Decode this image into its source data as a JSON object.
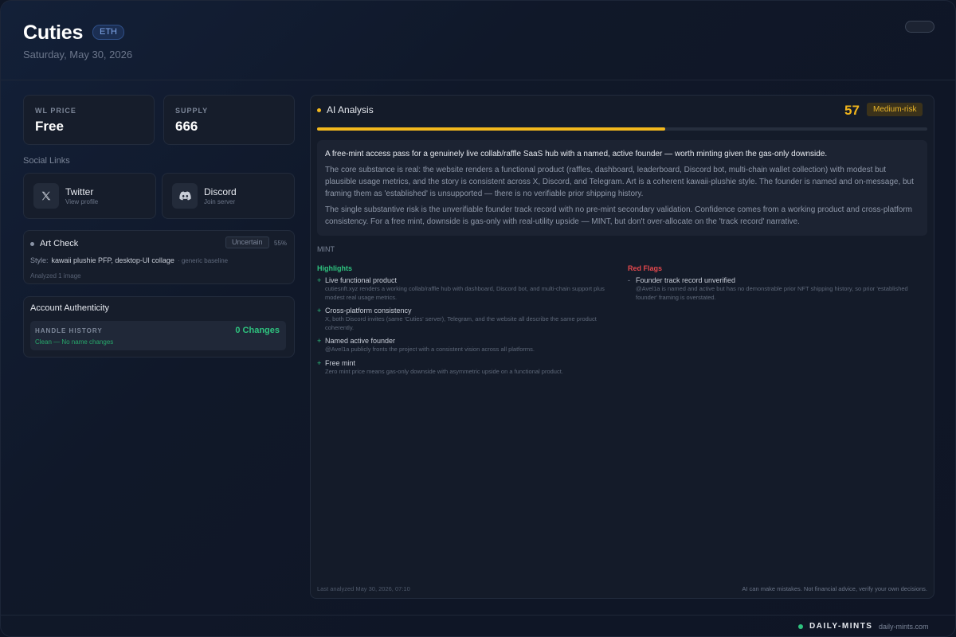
{
  "header": {
    "title": "Cuties",
    "chain": "ETH",
    "date": "Saturday, May 30, 2026"
  },
  "stats": {
    "wl_price_label": "WL PRICE",
    "wl_price_value": "Free",
    "supply_label": "SUPPLY",
    "supply_value": "666"
  },
  "social": {
    "section_title": "Social Links",
    "links": [
      {
        "name": "Twitter",
        "sub": "View profile",
        "icon": "x-logo-icon"
      },
      {
        "name": "Discord",
        "sub": "Join server",
        "icon": "discord-logo-icon"
      }
    ]
  },
  "art_check": {
    "title": "Art Check",
    "badge": "Uncertain",
    "confidence": "55%",
    "style_label": "Style:",
    "style_value": "kawaii plushie PFP, desktop-UI collage",
    "style_note": "· generic baseline",
    "analyzed": "Analyzed 1 image"
  },
  "authenticity": {
    "title": "Account Authenticity",
    "handle_label": "HANDLE HISTORY",
    "handle_count": "0 Changes",
    "handle_sub": "Clean — No name changes"
  },
  "ai": {
    "title": "AI Analysis",
    "score": "57",
    "score_fraction": 0.57,
    "risk": "Medium-risk",
    "summary_lead": "A free-mint access pass for a genuinely live collab/raffle SaaS hub with a named, active founder — worth minting given the gas-only downside.",
    "summary_p1": "The core substance is real: the website renders a functional product (raffles, dashboard, leaderboard, Discord bot, multi-chain wallet collection) with modest but plausible usage metrics, and the story is consistent across X, Discord, and Telegram. Art is a coherent kawaii-plushie style. The founder is named and on-message, but framing them as 'established' is unsupported — there is no verifiable prior shipping history.",
    "summary_p2": "The single substantive risk is the unverifiable founder track record with no pre-mint secondary validation. Confidence comes from a working product and cross-platform consistency. For a free mint, downside is gas-only with real-utility upside — MINT, but don't over-allocate on the 'track record' narrative.",
    "verdict": "MINT",
    "highlights_label": "Highlights",
    "highlights": [
      {
        "title": "Live functional product",
        "desc": "cutiesnft.xyz renders a working collab/raffle hub with dashboard, Discord bot, and multi-chain support plus modest real usage metrics."
      },
      {
        "title": "Cross-platform consistency",
        "desc": "X, both Discord invites (same 'Cuties' server), Telegram, and the website all describe the same product coherently."
      },
      {
        "title": "Named active founder",
        "desc": "@Avel1a publicly fronts the project with a consistent vision across all platforms."
      },
      {
        "title": "Free mint",
        "desc": "Zero mint price means gas-only downside with asymmetric upside on a functional product."
      }
    ],
    "redflags_label": "Red Flags",
    "redflags": [
      {
        "title": "Founder track record unverified",
        "desc": "@Avel1a is named and active but has no demonstrable prior NFT shipping history, so prior 'established founder' framing is overstated."
      }
    ],
    "last_analyzed": "Last analyzed May 30, 2026, 07:10",
    "disclaimer": "AI can make mistakes. Not financial advice, verify your own decisions."
  },
  "footer": {
    "brand": "DAILY-MINTS",
    "url": "daily-mints.com"
  },
  "colors": {
    "accent_yellow": "#f2b81d",
    "positive_green": "#2ec27e",
    "negative_red": "#e5484d",
    "chain_blue": "#7fa7ea"
  }
}
